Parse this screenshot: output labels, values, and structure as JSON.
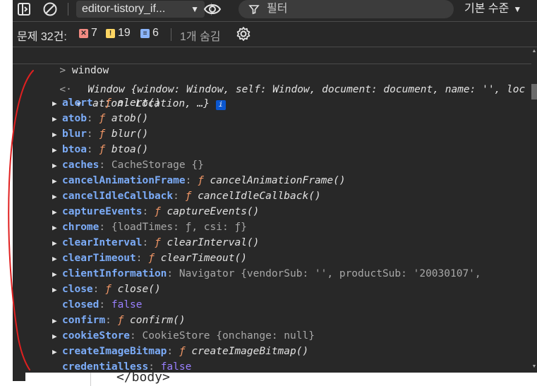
{
  "toolbar": {
    "context": "editor-tistory_if...",
    "filter_placeholder": "필터",
    "level": "기본 수준"
  },
  "issues": {
    "label": "문제 32건:",
    "errors": "7",
    "warnings": "19",
    "infos": "6",
    "hidden": "1개 숨김"
  },
  "console": {
    "input": "window",
    "object_preview_line1": "Window {window: Window, self: Window, document: document, name: '', loc",
    "object_preview_line2": "ation: Location, …}",
    "properties": [
      {
        "name": "alert",
        "sep": ": ",
        "kind": "fn",
        "value": "alert()",
        "expandable": true
      },
      {
        "name": "atob",
        "sep": ": ",
        "kind": "fn",
        "value": "atob()",
        "expandable": true
      },
      {
        "name": "blur",
        "sep": ": ",
        "kind": "fn",
        "value": "blur()",
        "expandable": true
      },
      {
        "name": "btoa",
        "sep": ": ",
        "kind": "fn",
        "value": "btoa()",
        "expandable": true
      },
      {
        "name": "caches",
        "sep": ": ",
        "kind": "obj",
        "value": "CacheStorage {}",
        "expandable": true
      },
      {
        "name": "cancelAnimationFrame",
        "sep": ": ",
        "kind": "fn",
        "value": "cancelAnimationFrame()",
        "expandable": true
      },
      {
        "name": "cancelIdleCallback",
        "sep": ": ",
        "kind": "fn",
        "value": "cancelIdleCallback()",
        "expandable": true
      },
      {
        "name": "captureEvents",
        "sep": ": ",
        "kind": "fn",
        "value": "captureEvents()",
        "expandable": true
      },
      {
        "name": "chrome",
        "sep": ": ",
        "kind": "obj",
        "value": "{loadTimes: ƒ, csi: ƒ}",
        "expandable": true
      },
      {
        "name": "clearInterval",
        "sep": ": ",
        "kind": "fn",
        "value": "clearInterval()",
        "expandable": true
      },
      {
        "name": "clearTimeout",
        "sep": ": ",
        "kind": "fn",
        "value": "clearTimeout()",
        "expandable": true
      },
      {
        "name": "clientInformation",
        "sep": ": ",
        "kind": "nav",
        "value": "Navigator {vendorSub: '', productSub: '20030107',",
        "expandable": true
      },
      {
        "name": "close",
        "sep": ": ",
        "kind": "fn",
        "value": "close()",
        "expandable": true
      },
      {
        "name": "closed",
        "sep": ": ",
        "kind": "kw",
        "value": "false",
        "expandable": false
      },
      {
        "name": "confirm",
        "sep": ": ",
        "kind": "fn",
        "value": "confirm()",
        "expandable": true
      },
      {
        "name": "cookieStore",
        "sep": ": ",
        "kind": "obj",
        "value": "CookieStore {onchange: null}",
        "expandable": true
      },
      {
        "name": "createImageBitmap",
        "sep": ": ",
        "kind": "fn",
        "value": "createImageBitmap()",
        "expandable": true
      },
      {
        "name": "credentialless",
        "sep": ": ",
        "kind": "kw",
        "value": "false",
        "expandable": false
      }
    ]
  },
  "source_strip": {
    "text": "</body>"
  },
  "colors": {
    "background": "#282828",
    "property_name": "#7cacf8",
    "function_f": "#f29766",
    "keyword": "#9980ff",
    "string": "#5cd5fb",
    "error_badge": "#f28b82",
    "warning_badge": "#fdd663",
    "info_badge": "#8ab4f8",
    "annotation": "#e02020"
  },
  "icons": {
    "dock": "sidebar-toggle-icon",
    "clear": "clear-console-icon",
    "eye": "live-expression-eye-icon",
    "filter": "filter-funnel-icon",
    "settings": "gear-icon"
  }
}
